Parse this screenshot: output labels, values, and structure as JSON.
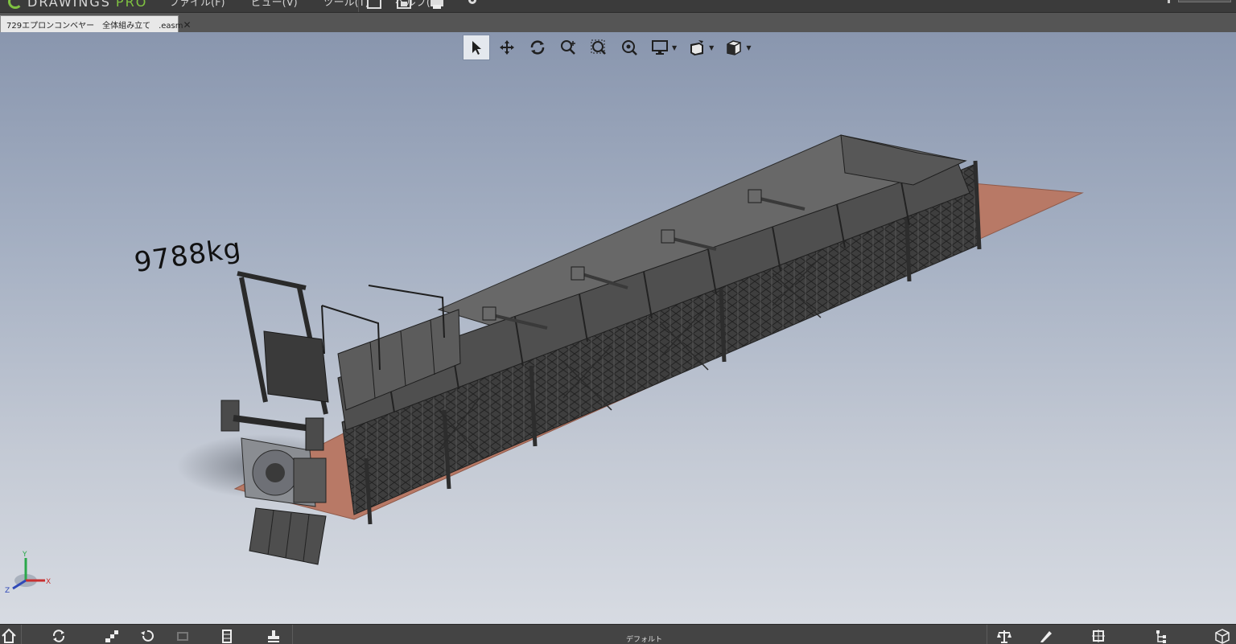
{
  "app": {
    "logo_text": "DRAWINGS",
    "logo_suffix": "PRO",
    "menu": [
      "ファイル(F)",
      "ビュー(V)",
      "ツール(T)",
      "ヘルプ(H)"
    ]
  },
  "document_tab": {
    "label": "729エプロンコンベヤー　全体組み立て　.easm",
    "close_glyph": "✕"
  },
  "viewport": {
    "annotation": "9788kg",
    "triad_labels": {
      "x": "X",
      "y": "Y",
      "z": "Z"
    },
    "toolbar": [
      {
        "name": "select-icon",
        "active": true
      },
      {
        "name": "pan-icon"
      },
      {
        "name": "rotate-icon"
      },
      {
        "name": "zoom-icon"
      },
      {
        "name": "zoom-area-icon"
      },
      {
        "name": "zoom-fit-icon"
      },
      {
        "name": "display-icon",
        "dropdown": true
      },
      {
        "name": "appearance-icon",
        "dropdown": true
      },
      {
        "name": "view-orientation-icon",
        "dropdown": true
      }
    ]
  },
  "bottom_bar": {
    "config_label": "デフォルト"
  },
  "colors": {
    "accent": "#7fc241",
    "floor": "#b87966",
    "steel": "#555555",
    "background_top": "#8996ae",
    "background_bottom": "#d7dbe2"
  }
}
